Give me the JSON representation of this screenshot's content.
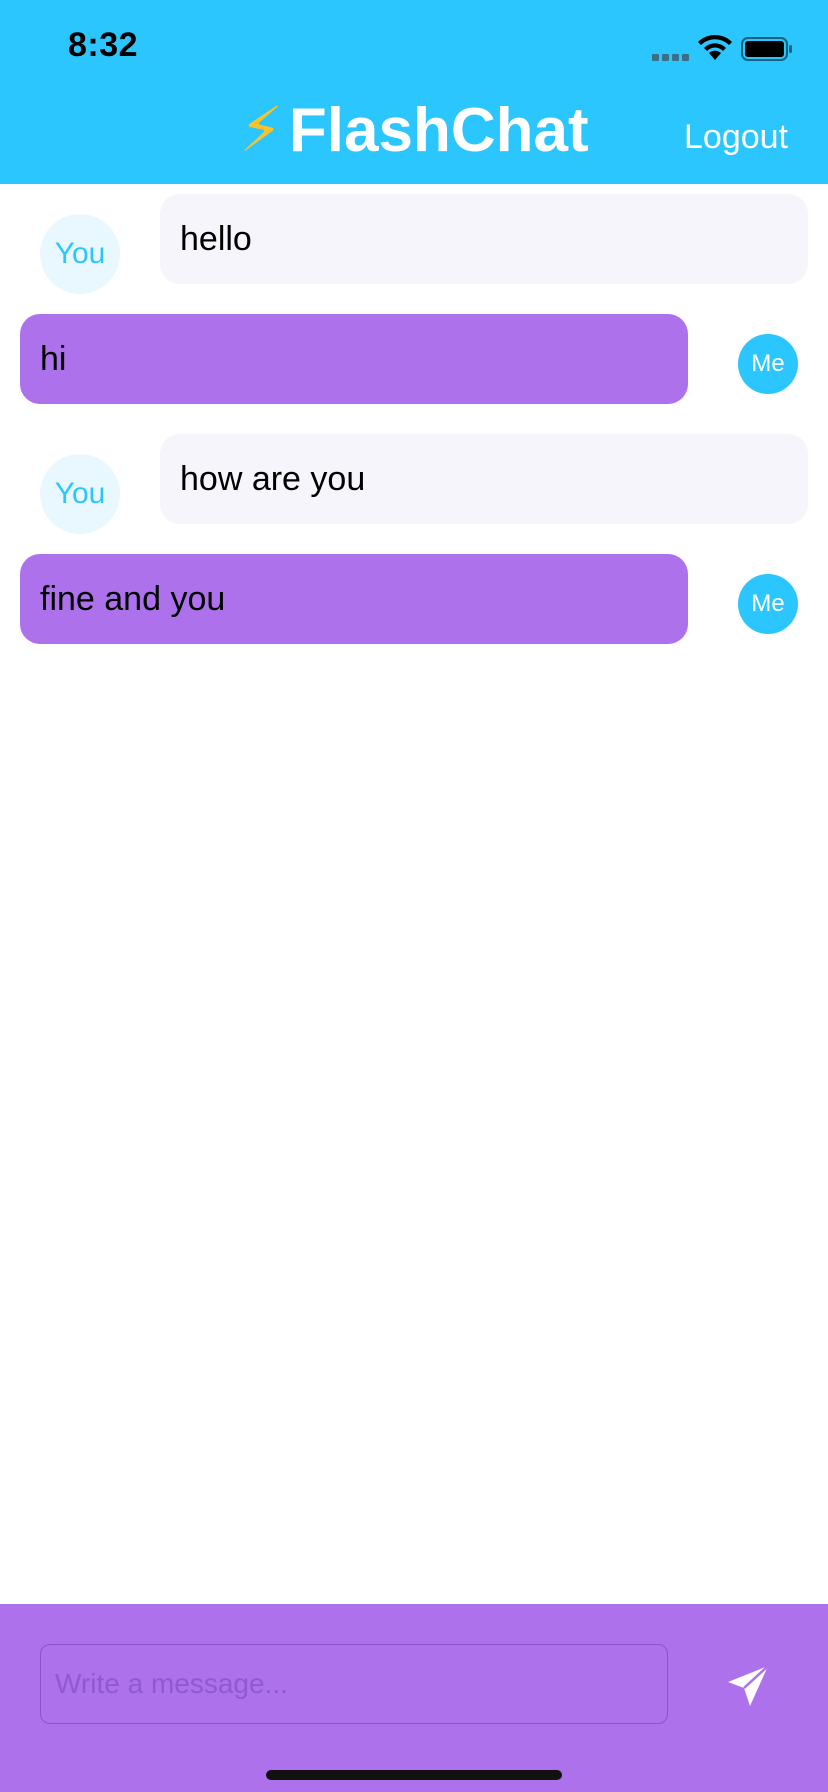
{
  "status_bar": {
    "time": "8:32"
  },
  "header": {
    "bolt_icon": "⚡",
    "title": "FlashChat",
    "logout_label": "Logout",
    "background_color": "#2BC6FE"
  },
  "messages": [
    {
      "sender": "You",
      "text": "hello",
      "direction": "received"
    },
    {
      "sender": "Me",
      "text": "hi",
      "direction": "sent"
    },
    {
      "sender": "You",
      "text": "how are you",
      "direction": "received"
    },
    {
      "sender": "Me",
      "text": "fine and you",
      "direction": "sent"
    }
  ],
  "composer": {
    "placeholder": "Write a message...",
    "value": "",
    "send_icon": "paper-plane-icon",
    "background_color": "#AC71EB"
  },
  "colors": {
    "accent": "#2BC6FE",
    "sent_bubble": "#AC71EB",
    "received_bubble": "#F7F5FC"
  }
}
